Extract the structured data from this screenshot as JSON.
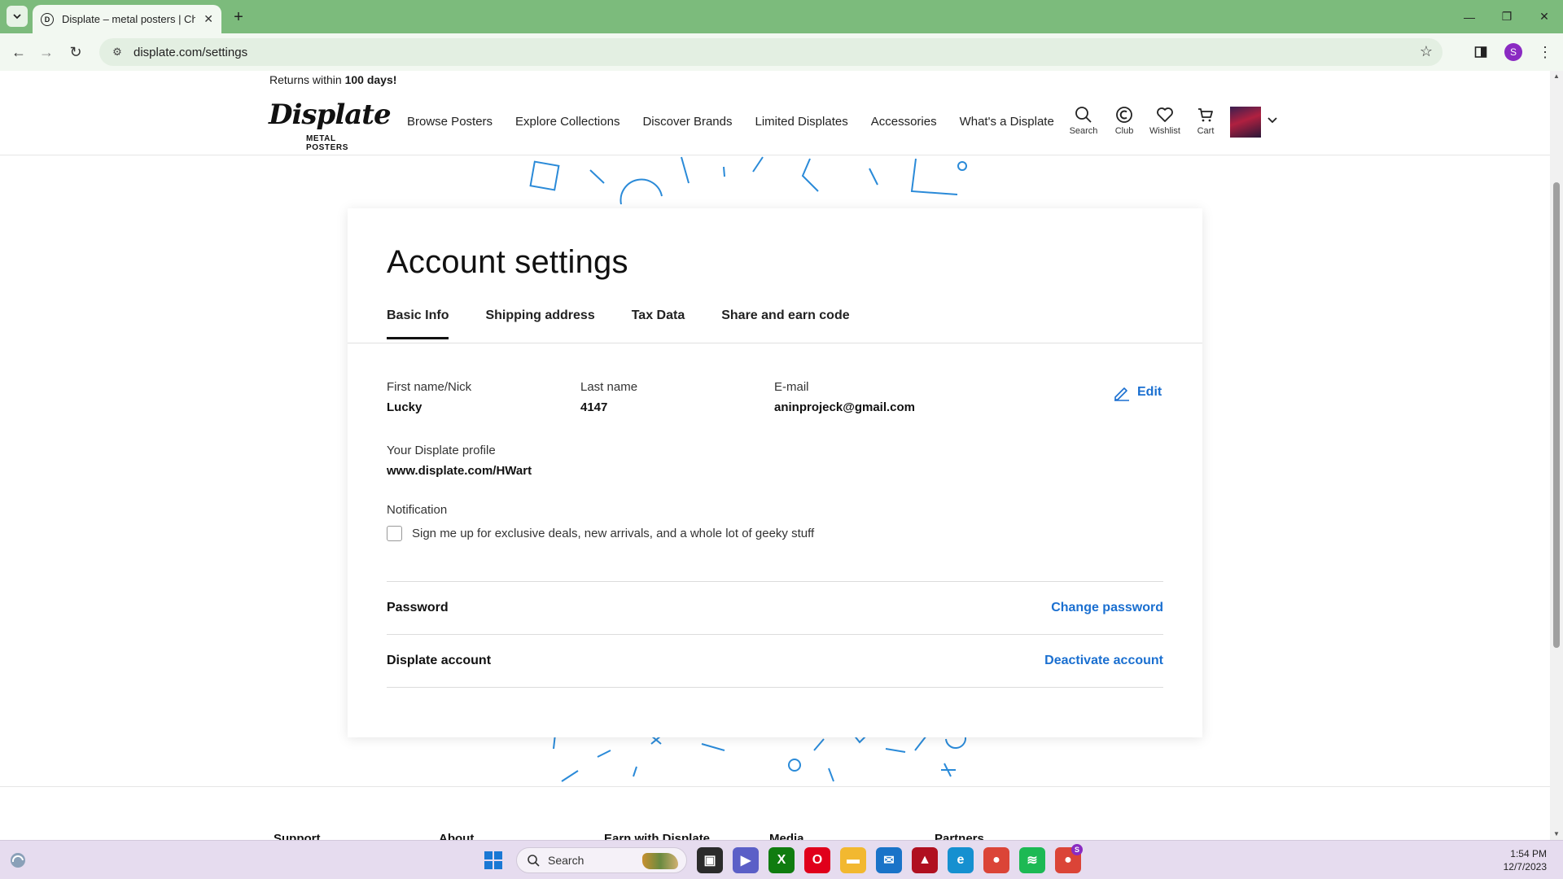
{
  "browser": {
    "tab_title": "Displate – metal posters | Chan",
    "url": "displate.com/settings",
    "profile_initial": "S"
  },
  "promo": {
    "prefix": "Returns within ",
    "bold": "100 days!"
  },
  "header": {
    "logo_word": "Displate",
    "logo_sub": "METAL POSTERS",
    "nav": [
      "Browse Posters",
      "Explore Collections",
      "Discover Brands",
      "Limited Displates",
      "Accessories",
      "What's a Displate"
    ],
    "icons": [
      {
        "label": "Search",
        "icon": "search-icon"
      },
      {
        "label": "Club",
        "icon": "club-icon"
      },
      {
        "label": "Wishlist",
        "icon": "heart-icon"
      },
      {
        "label": "Cart",
        "icon": "cart-icon"
      }
    ]
  },
  "settings": {
    "title": "Account settings",
    "tabs": [
      "Basic Info",
      "Shipping address",
      "Tax Data",
      "Share and earn code"
    ],
    "active_tab": "Basic Info",
    "fields": {
      "first_name": {
        "label": "First name/Nick",
        "value": "Lucky"
      },
      "last_name": {
        "label": "Last name",
        "value": "4147"
      },
      "email": {
        "label": "E-mail",
        "value": "aninprojeck@gmail.com"
      },
      "profile": {
        "label": "Your Displate profile",
        "value": "www.displate.com/HWart"
      }
    },
    "edit_label": "Edit",
    "notification_label": "Notification",
    "notification_checkbox": "Sign me up for exclusive deals, new arrivals, and a whole lot of geeky stuff",
    "notification_checked": false,
    "password_label": "Password",
    "password_action": "Change password",
    "account_label": "Displate account",
    "account_action": "Deactivate account"
  },
  "footer": {
    "columns": [
      "Support",
      "About",
      "Earn with Displate",
      "Media",
      "Partners"
    ]
  },
  "taskbar": {
    "search_label": "Search",
    "time": "1:54 PM",
    "date": "12/7/2023",
    "badge": "S"
  },
  "colors": {
    "tabbar": "#7cbb7c",
    "link_blue": "#1a6fd0",
    "deco_blue": "#2a8ad8",
    "taskbar": "#e6dcef"
  }
}
